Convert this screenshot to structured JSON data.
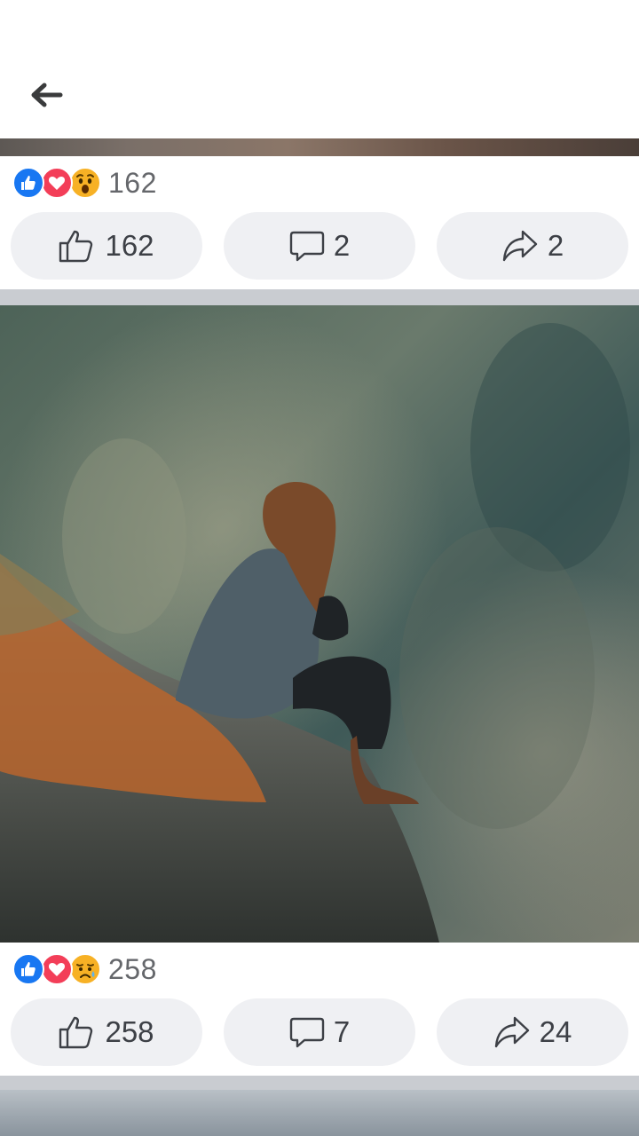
{
  "header": {
    "back_icon": "arrow-left-icon"
  },
  "posts": [
    {
      "reactions": {
        "icons": [
          "like-icon",
          "love-icon",
          "wow-icon"
        ],
        "count": "162"
      },
      "actions": {
        "like_count": "162",
        "comment_count": "2",
        "share_count": "2"
      }
    },
    {
      "reactions": {
        "icons": [
          "like-icon",
          "love-icon",
          "sad-icon"
        ],
        "count": "258"
      },
      "actions": {
        "like_count": "258",
        "comment_count": "7",
        "share_count": "24"
      }
    }
  ],
  "colors": {
    "like": "#1877f2",
    "love": "#f33e58",
    "emoji": "#f7b125",
    "separator": "#c9ccd1",
    "pill": "#eff0f3"
  }
}
